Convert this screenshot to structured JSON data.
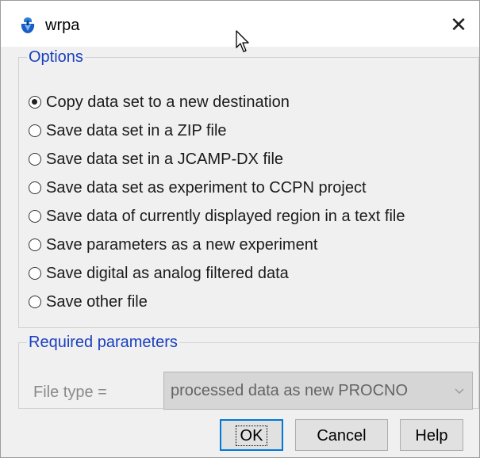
{
  "window": {
    "title": "wrpa",
    "close_glyph": "✕",
    "app_icon": "bruker-app-icon"
  },
  "options": {
    "legend": "Options",
    "items": [
      {
        "label": "Copy data set to a new destination",
        "checked": true
      },
      {
        "label": "Save data set in a ZIP file",
        "checked": false
      },
      {
        "label": "Save data set in a JCAMP-DX file",
        "checked": false
      },
      {
        "label": "Save data set as experiment to CCPN project",
        "checked": false
      },
      {
        "label": "Save data of currently displayed region in a text file",
        "checked": false
      },
      {
        "label": "Save parameters as a new experiment",
        "checked": false
      },
      {
        "label": "Save digital as analog filtered data",
        "checked": false
      },
      {
        "label": "Save other file",
        "checked": false
      }
    ]
  },
  "params": {
    "legend": "Required parameters",
    "file_type_label": "File type =",
    "file_type_value": "processed data as new PROCNO"
  },
  "buttons": {
    "ok": "OK",
    "cancel": "Cancel",
    "help": "Help"
  },
  "colors": {
    "legend": "#1a3fbf",
    "focus": "#0078d7",
    "icon_blue": "#2b7de0"
  }
}
